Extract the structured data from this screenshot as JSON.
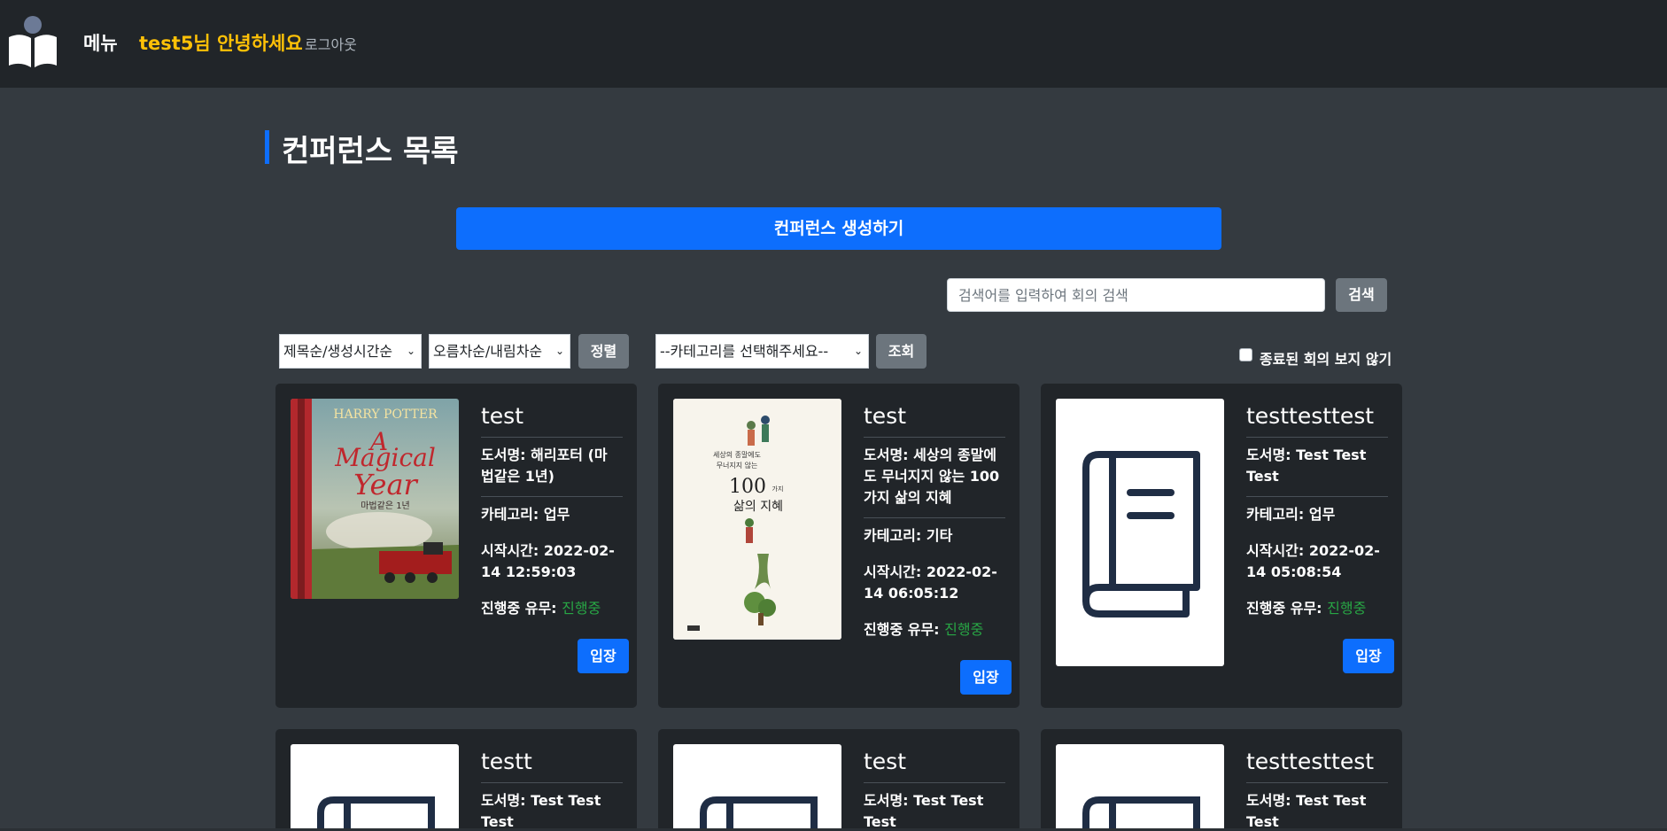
{
  "nav": {
    "menu_label": "메뉴",
    "greeting": "test5님 안녕하세요",
    "logout_label": "로그아웃",
    "logo_icon": "book-reader-icon"
  },
  "page": {
    "title": "컨퍼런스 목록",
    "create_button": "컨퍼런스 생성하기"
  },
  "search": {
    "placeholder": "검색어를 입력하여 회의 검색",
    "value": "",
    "button": "검색"
  },
  "filters": {
    "sort_field": "제목순/생성시간순",
    "sort_order": "오름차순/내림차순",
    "sort_button": "정렬",
    "category": "--카테고리를 선택해주세요--",
    "lookup_button": "조회",
    "hide_ended_label": "종료된 회의 보지 않기",
    "hide_ended_checked": false
  },
  "labels": {
    "book": "도서명: ",
    "category": "카테고리: ",
    "start_time": "시작시간: ",
    "status": "진행중 유무: ",
    "enter": "입장"
  },
  "conferences": [
    {
      "title": "test",
      "book_l1": "해리포터 (마",
      "book_l2": "법같은 1년)",
      "category": "업무",
      "start_l1": "2022-02-",
      "start_l2": "14 12:59:03",
      "status": "진행중",
      "cover_title_top": "HARRY POTTER",
      "cover_title_a": "A",
      "cover_title_b": "Magical",
      "cover_title_c": "Year",
      "cover_sub": "마법같은 1년"
    },
    {
      "title": "test",
      "book_l1": "세상의 종말에",
      "book_l2": "도 무너지지 않는 100",
      "book_l3": "가지 삶의 지혜",
      "category": "기타",
      "start_l1": "2022-02-",
      "start_l2": "14 06:05:12",
      "status": "진행중",
      "cover_line1": "세상의 종말에도",
      "cover_line2": "무너지지 않는",
      "cover_big": "100",
      "cover_small": "가지",
      "cover_line3": "삶의 지혜"
    },
    {
      "title": "testtesttest",
      "book_l1": "Test Test",
      "book_l2": "Test",
      "category": "업무",
      "start_l1": "2022-02-",
      "start_l2": "14 05:08:54",
      "status": "진행중"
    },
    {
      "title": "testt",
      "book_l1": "Test Test",
      "book_l2": "Test"
    },
    {
      "title": "test",
      "book_l1": "Test Test",
      "book_l2": "Test"
    },
    {
      "title": "testtesttest",
      "book_l1": "Test Test",
      "book_l2": "Test"
    }
  ],
  "colors": {
    "navbar": "#212529",
    "page_bg": "#343a40",
    "primary": "#0d6efd",
    "secondary": "#6c757d",
    "greeting": "#ffc107",
    "status": "#28a745"
  }
}
